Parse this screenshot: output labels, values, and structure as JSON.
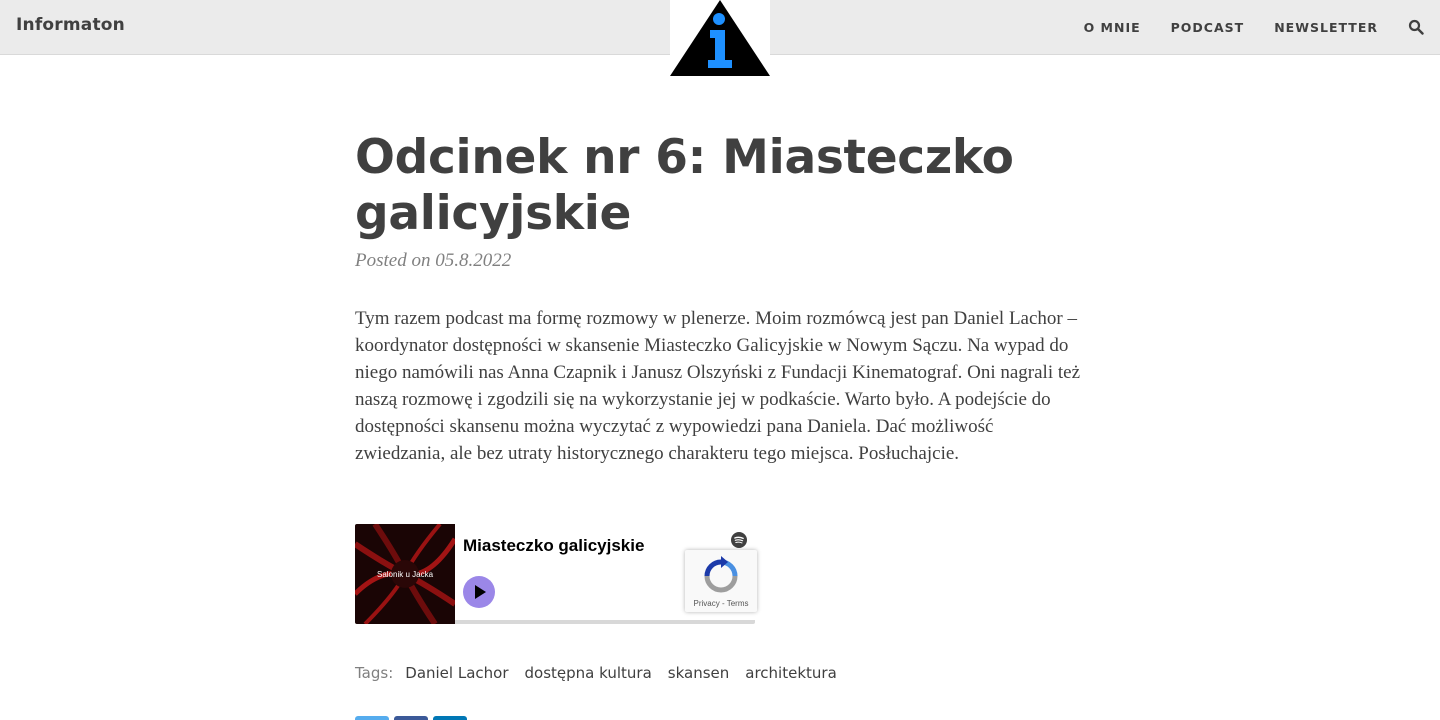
{
  "navbar": {
    "brand": "Informaton",
    "links": [
      "O MNIE",
      "PODCAST",
      "NEWSLETTER"
    ],
    "search_icon": "search-icon"
  },
  "logo": {
    "icon": "info-triangle-logo",
    "triangle_color": "#000000",
    "letter_color": "#1e90ff"
  },
  "post": {
    "title": "Odcinek nr 6: Miasteczko galicyjskie",
    "meta": "Posted on 05.8.2022",
    "body": "Tym razem podcast ma formę rozmowy w plenerze. Moim rozmówcą jest pan Daniel Lachor – koordynator dostępności w skansenie Miasteczko Galicyjskie w Nowym Sączu. Na wypad do niego namówili nas Anna Czapnik i Janusz Olszyński z Fundacji Kinematograf. Oni nagrali też naszą rozmowę i zgodzili się na wykorzystanie jej w podkaście. Warto było. A podejście do dostępności skansenu można wyczytać z wypowiedzi pana Daniela. Dać możliwość zwiedzania, ale bez utraty historycznego charakteru tego miejsca. Posłuchajcie."
  },
  "embed": {
    "cover_text": "Salonik u Jacka",
    "title": "Miasteczko galicyjskie",
    "play_color": "#9b87e8",
    "spotify_icon": "spotify-icon"
  },
  "recaptcha": {
    "links": "Privacy - Terms"
  },
  "tags": {
    "label": "Tags:",
    "items": [
      "Daniel Lachor",
      "dostępna kultura",
      "skansen",
      "architektura"
    ]
  },
  "share": {
    "colors": [
      "#55acee",
      "#3b5998",
      "#0077b5"
    ]
  }
}
